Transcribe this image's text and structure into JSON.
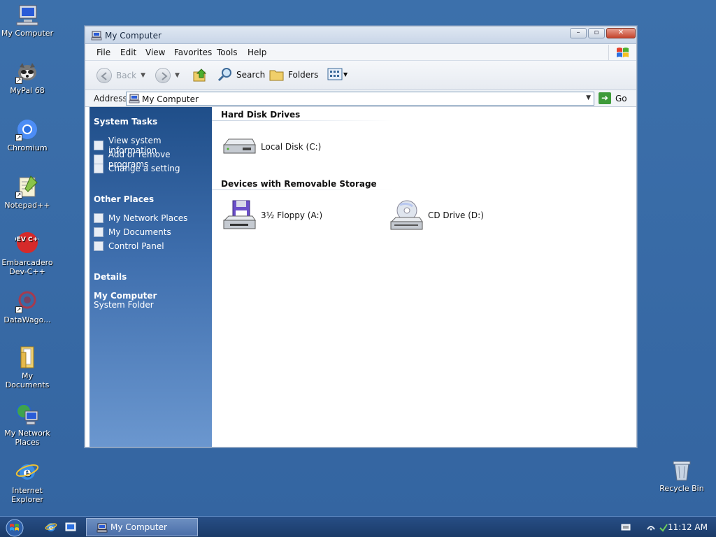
{
  "desktop": {
    "icons": [
      {
        "label": "My Computer"
      },
      {
        "label": "MyPal 68"
      },
      {
        "label": "Chromium"
      },
      {
        "label": "Notepad++"
      },
      {
        "label": "Embarcadero Dev-C++",
        "logo_text": "DEV C++"
      },
      {
        "label": "DataWago..."
      },
      {
        "label": "My Documents"
      },
      {
        "label": "My Network Places"
      },
      {
        "label": "Internet Explorer"
      }
    ],
    "recycle_bin": "Recycle Bin"
  },
  "window": {
    "title": "My Computer",
    "menu": [
      "File",
      "Edit",
      "View",
      "Favorites",
      "Tools",
      "Help"
    ],
    "toolbar": {
      "back": "Back",
      "search": "Search",
      "folders": "Folders"
    },
    "address": {
      "label": "Address",
      "value": "My Computer",
      "go": "Go"
    },
    "taskpane": {
      "system_tasks": {
        "title": "System Tasks",
        "items": [
          "View system information",
          "Add or remove programs",
          "Change a setting"
        ]
      },
      "other_places": {
        "title": "Other Places",
        "items": [
          "My Network Places",
          "My Documents",
          "Control Panel"
        ]
      },
      "details": {
        "title": "Details",
        "name": "My Computer",
        "type": "System Folder"
      }
    },
    "content": {
      "groups": [
        {
          "title": "Hard Disk Drives",
          "items": [
            "Local Disk (C:)"
          ]
        },
        {
          "title": "Devices with Removable Storage",
          "items": [
            "3½ Floppy (A:)",
            "CD Drive (D:)"
          ]
        }
      ]
    }
  },
  "taskbar": {
    "task": "My Computer",
    "clock": "11:12 AM"
  },
  "colors": {
    "desktop": "#3a6ea5",
    "taskbar": "#1f4372",
    "taskpane_top": "#1f4e89",
    "taskpane_bottom": "#6b97cf"
  }
}
